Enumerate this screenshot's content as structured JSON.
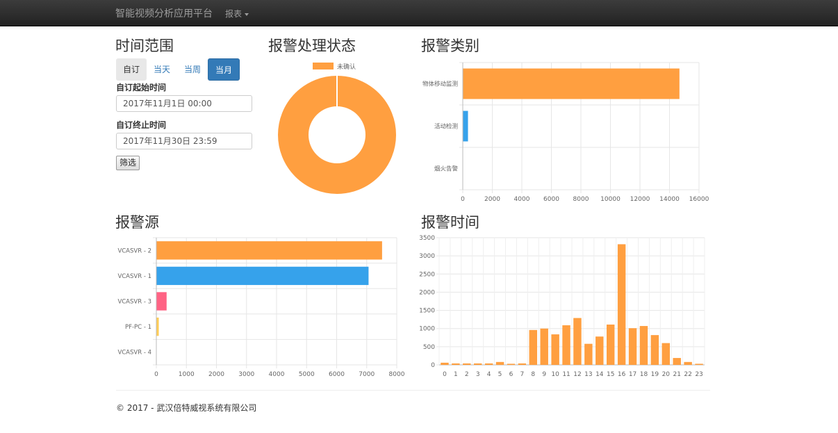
{
  "nav": {
    "brand": "智能视频分析应用平台",
    "report_menu": "报表"
  },
  "time_range": {
    "title": "时间范围",
    "buttons": [
      "自订",
      "当天",
      "当周",
      "当月"
    ],
    "start_label": "自订起始时间",
    "start_value": "2017年11月1日 00:00",
    "end_label": "自订终止时间",
    "end_value": "2017年11月30日 23:59",
    "filter_label": "筛选"
  },
  "status_panel": {
    "title": "报警处理状态",
    "chart_data": {
      "type": "pie",
      "title": "",
      "legend": "top",
      "slices": [
        {
          "name": "未确认",
          "value": 100,
          "color": "#ff9f40"
        }
      ]
    }
  },
  "category_panel": {
    "title": "报警类别",
    "chart_data": {
      "type": "bar",
      "orientation": "horizontal",
      "categories": [
        "物体移动监测",
        "活动检测",
        "烟火告警"
      ],
      "values": [
        14650,
        330,
        0
      ],
      "colors": [
        "#ff9f40",
        "#36a2eb",
        "#ff6384"
      ],
      "xlim": [
        0,
        16000
      ],
      "xticks": [
        0,
        2000,
        4000,
        6000,
        8000,
        10000,
        12000,
        14000,
        16000
      ],
      "grid": true
    }
  },
  "source_panel": {
    "title": "报警源",
    "chart_data": {
      "type": "bar",
      "orientation": "horizontal",
      "categories": [
        "VCASVR - 2",
        "VCASVR - 1",
        "VCASVR - 3",
        "PF-PC - 1",
        "VCASVR - 4"
      ],
      "values": [
        7500,
        7050,
        330,
        70,
        0
      ],
      "colors": [
        "#ff9f40",
        "#36a2eb",
        "#ff6384",
        "#ffcd56",
        "#4bc0c0"
      ],
      "xlim": [
        0,
        8000
      ],
      "xticks": [
        0,
        1000,
        2000,
        3000,
        4000,
        5000,
        6000,
        7000,
        8000
      ],
      "grid": true
    }
  },
  "time_panel": {
    "title": "报警时间",
    "chart_data": {
      "type": "bar",
      "categories": [
        "0",
        "1",
        "2",
        "3",
        "4",
        "5",
        "6",
        "7",
        "8",
        "9",
        "10",
        "11",
        "12",
        "13",
        "14",
        "15",
        "16",
        "17",
        "18",
        "19",
        "20",
        "21",
        "22",
        "23"
      ],
      "values": [
        60,
        40,
        40,
        40,
        40,
        80,
        30,
        40,
        960,
        1000,
        840,
        1090,
        1290,
        580,
        780,
        1110,
        3320,
        1010,
        1070,
        820,
        600,
        190,
        80,
        30
      ],
      "color": "#ff9f40",
      "ylim": [
        0,
        3500
      ],
      "yticks": [
        0,
        500,
        1000,
        1500,
        2000,
        2500,
        3000,
        3500
      ],
      "grid": true
    }
  },
  "footer": {
    "text": "© 2017 - 武汉倍特威视系统有限公司"
  }
}
